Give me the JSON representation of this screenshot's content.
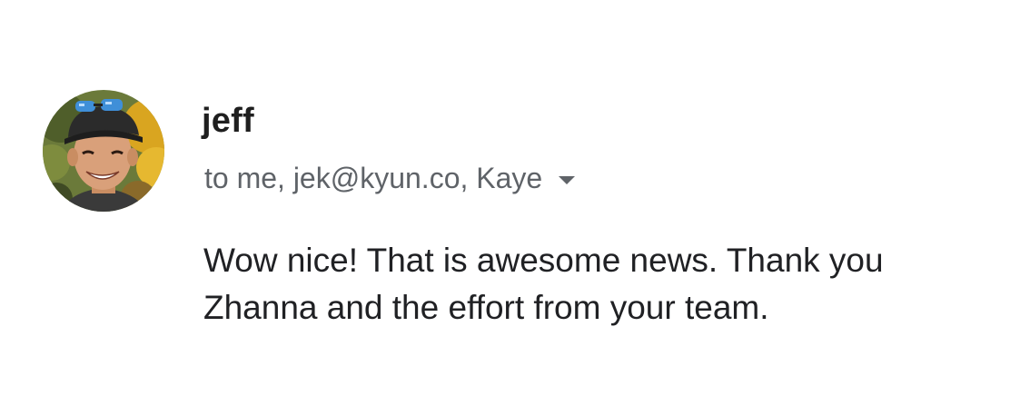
{
  "message": {
    "sender": {
      "name": "jeff",
      "avatar_icon": "user-photo-avatar"
    },
    "recipients_text": "to me, jek@kyun.co, Kaye",
    "expand_icon": "chevron-down-icon",
    "body_lines": [
      "Wow nice! That is awesome news. Thank you",
      "Zhanna and the effort from your team."
    ]
  },
  "colors": {
    "background": "#ffffff",
    "sender_text": "#1f1f1f",
    "secondary_text": "#5f6368",
    "body_text": "#202124"
  }
}
